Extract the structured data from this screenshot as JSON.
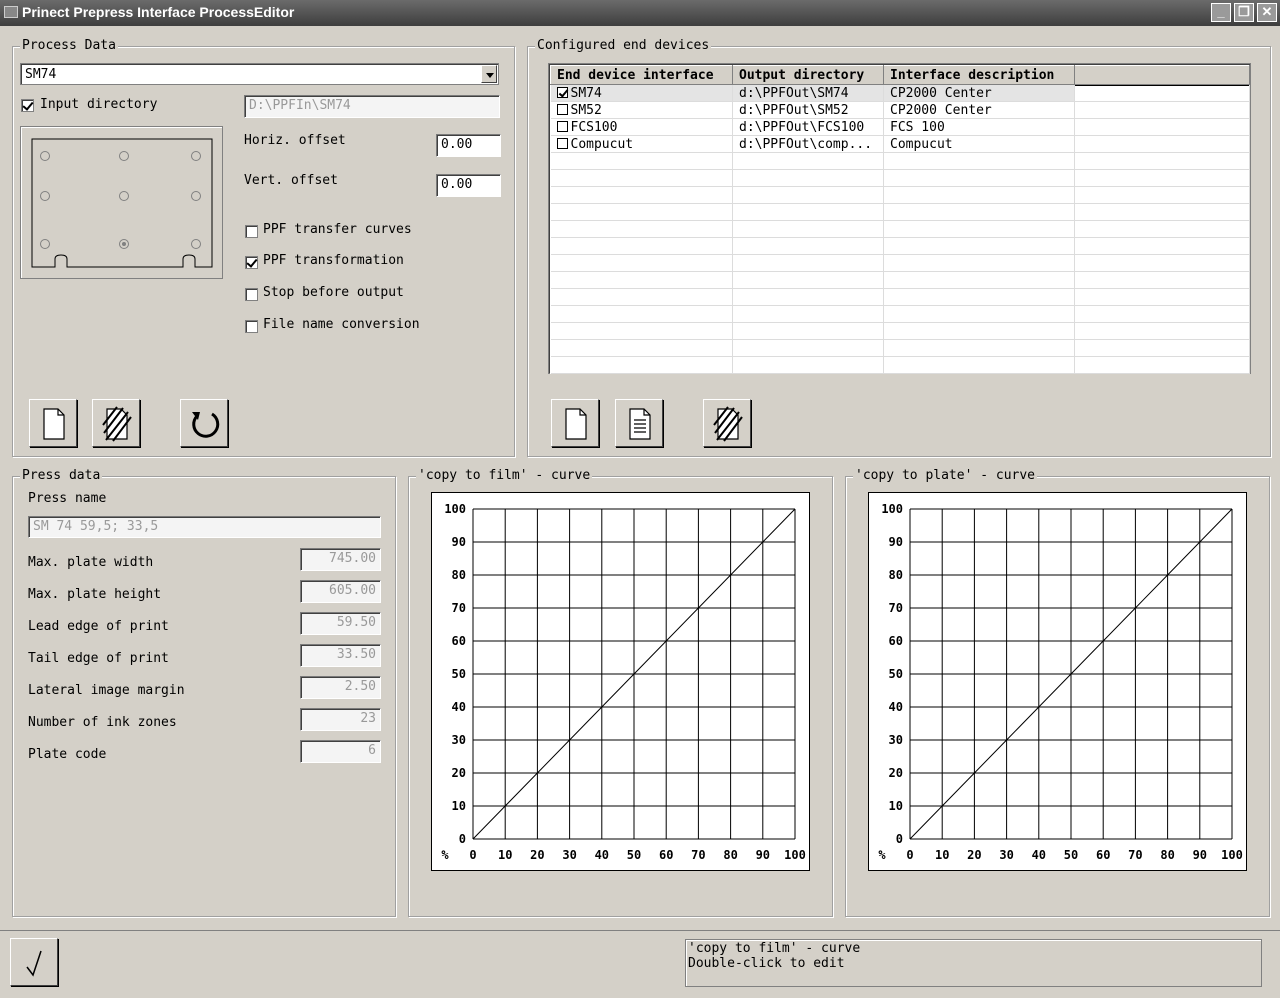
{
  "window": {
    "title": "Prinect Prepress Interface ProcessEditor"
  },
  "process_data": {
    "group_title": "Process Data",
    "selected_process": "SM74",
    "input_directory_label": "Input directory",
    "input_directory_checked": true,
    "input_directory_value": "D:\\PPFIn\\SM74",
    "horiz_offset_label": "Horiz. offset",
    "horiz_offset_value": "0.00",
    "vert_offset_label": "Vert. offset",
    "vert_offset_value": "0.00",
    "options": [
      {
        "label": "PPF transfer curves",
        "checked": false
      },
      {
        "label": "PPF transformation",
        "checked": true
      },
      {
        "label": "Stop before output",
        "checked": false
      },
      {
        "label": "File name conversion",
        "checked": false
      }
    ],
    "selected_anchor": "bottom-center"
  },
  "end_devices": {
    "group_title": "Configured end devices",
    "columns": [
      "End device interface",
      "Output directory",
      "Interface description"
    ],
    "rows": [
      {
        "name": "SM74",
        "checked": true,
        "output": "d:\\PPFOut\\SM74",
        "description": "CP2000 Center"
      },
      {
        "name": "SM52",
        "checked": false,
        "output": "d:\\PPFOut\\SM52",
        "description": "CP2000 Center"
      },
      {
        "name": "FCS100",
        "checked": false,
        "output": "d:\\PPFOut\\FCS100",
        "description": "FCS 100"
      },
      {
        "name": "Compucut",
        "checked": false,
        "output": "d:\\PPFOut\\comp...",
        "description": "Compucut"
      }
    ]
  },
  "press_data": {
    "group_title": "Press data",
    "press_name_label": "Press name",
    "press_name_value": "SM 74 59,5; 33,5",
    "fields": [
      {
        "label": "Max. plate width",
        "value": "745.00"
      },
      {
        "label": "Max. plate height",
        "value": "605.00"
      },
      {
        "label": "Lead edge of print",
        "value": "59.50"
      },
      {
        "label": "Tail edge of print",
        "value": "33.50"
      },
      {
        "label": "Lateral image margin",
        "value": "2.50"
      },
      {
        "label": "Number of ink zones",
        "value": "23"
      },
      {
        "label": "Plate code",
        "value": "6"
      }
    ]
  },
  "chart_data": [
    {
      "type": "line",
      "title": "'copy to film' - curve",
      "x_unit_label": "%",
      "x": [
        0,
        10,
        20,
        30,
        40,
        50,
        60,
        70,
        80,
        90,
        100
      ],
      "y": [
        0,
        10,
        20,
        30,
        40,
        50,
        60,
        70,
        80,
        90,
        100
      ],
      "xlim": [
        0,
        100
      ],
      "ylim": [
        0,
        100
      ],
      "xticks": [
        "0",
        "10",
        "20",
        "30",
        "40",
        "50",
        "60",
        "70",
        "80",
        "90",
        "100"
      ],
      "yticks": [
        "0",
        "10",
        "20",
        "30",
        "40",
        "50",
        "60",
        "70",
        "80",
        "90",
        "100"
      ],
      "grid": true
    },
    {
      "type": "line",
      "title": "'copy to plate' - curve",
      "x_unit_label": "%",
      "x": [
        0,
        10,
        20,
        30,
        40,
        50,
        60,
        70,
        80,
        90,
        100
      ],
      "y": [
        0,
        10,
        20,
        30,
        40,
        50,
        60,
        70,
        80,
        90,
        100
      ],
      "xlim": [
        0,
        100
      ],
      "ylim": [
        0,
        100
      ],
      "xticks": [
        "0",
        "10",
        "20",
        "30",
        "40",
        "50",
        "60",
        "70",
        "80",
        "90",
        "100"
      ],
      "yticks": [
        "0",
        "10",
        "20",
        "30",
        "40",
        "50",
        "60",
        "70",
        "80",
        "90",
        "100"
      ],
      "grid": true
    }
  ],
  "status": {
    "message_line1": "'copy to film' - curve",
    "message_line2": "Double-click to edit"
  },
  "icons": {
    "new": "new-document-icon",
    "delete": "delete-icon",
    "refresh": "refresh-icon",
    "properties": "properties-icon",
    "ok": "checkmark-icon"
  }
}
